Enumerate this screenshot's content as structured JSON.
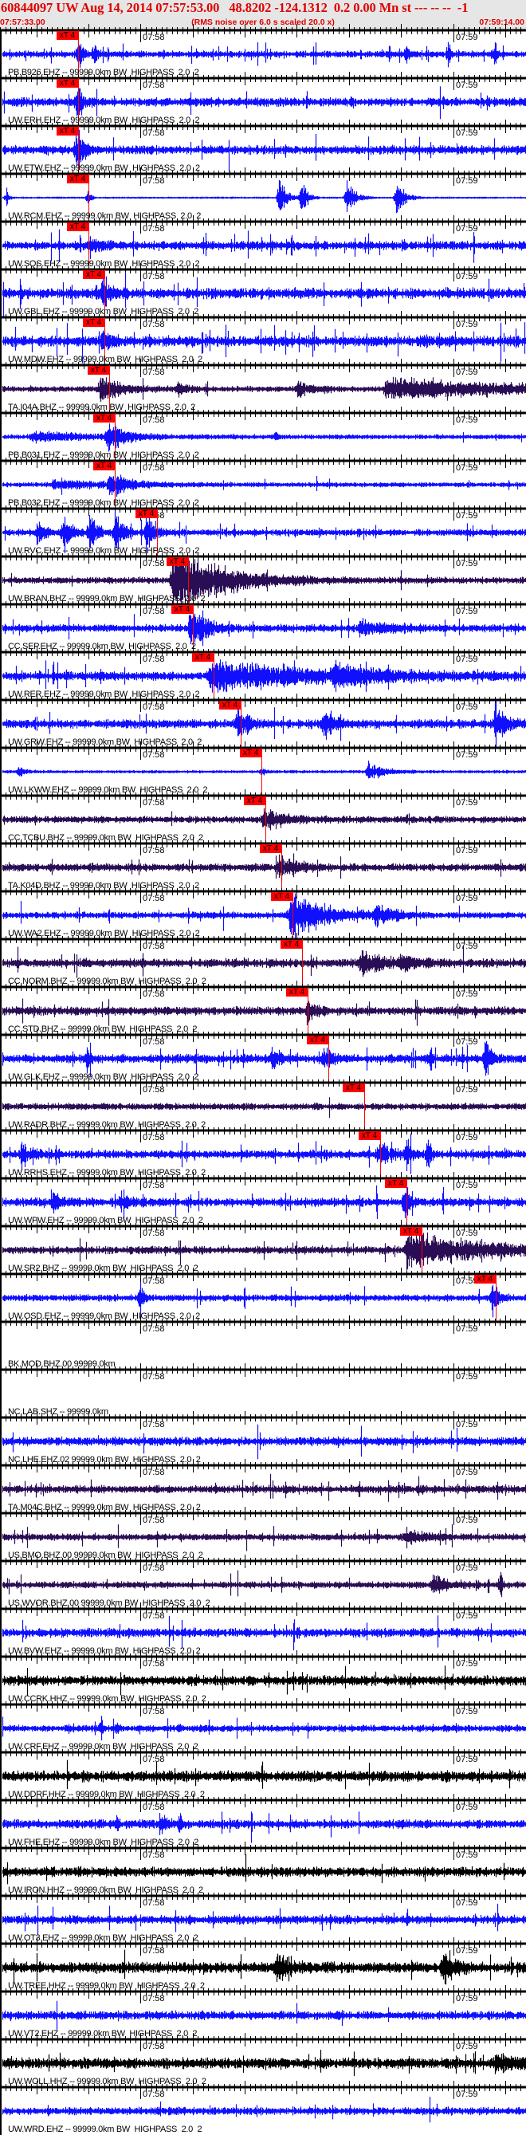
{
  "header": {
    "title": "60844097 UW Aug 14, 2014 07:57:53.00   48.8202 -124.1312  0.2 0.00 Mn st --- -- --  -1",
    "start_time": "07:57:33.00",
    "rms_note": "(RMS noise over 6.0 s scaled 20.0 x)",
    "end_time": "07:59:14.00"
  },
  "axis": {
    "duration_s": 101,
    "minute_marks": [
      {
        "t": 27,
        "label": "07:58"
      },
      {
        "t": 87,
        "label": "07:59"
      }
    ],
    "major_tick_every_s": 10,
    "first_major_s": 7
  },
  "pick_label": "xT 4",
  "colors": {
    "blue": "#1010ff",
    "purple": "#2a0e55",
    "black": "#000000",
    "pick": "#ff0000",
    "header_bg": "#e6e6e6"
  },
  "traces": [
    {
      "label": "PB.B926.EHZ -- 99999.0km BW  HIGHPASS  2.0  2",
      "color": "blue",
      "pick_s": 15.0,
      "noise": 3,
      "spiky": 0.08,
      "events": [
        [
          15,
          26,
          0.6
        ],
        [
          18,
          18,
          0.5
        ],
        [
          78,
          25,
          0.3
        ],
        [
          86,
          18,
          0.4
        ],
        [
          95,
          22,
          0.3
        ]
      ]
    },
    {
      "label": "UW.ERH.EHZ -- 99999.0km BW  HIGHPASS  2.0  2",
      "color": "blue",
      "pick_s": 15.0,
      "noise": 4,
      "spiky": 0.03,
      "events": [
        [
          14.6,
          29,
          1.0
        ]
      ]
    },
    {
      "label": "UW.ETW.EHZ -- 99999.0km BW  HIGHPASS  2.0  2",
      "color": "blue",
      "pick_s": 15.0,
      "noise": 4,
      "spiky": 0.03,
      "events": [
        [
          14.6,
          29,
          1.2
        ]
      ]
    },
    {
      "label": "UW.RCM.EHZ -- 99999.0km BW  HIGHPASS  2.0  2",
      "color": "blue",
      "pick_s": 17.0,
      "noise": 0.6,
      "spiky": 0.0,
      "events": [
        [
          1.2,
          12,
          0.4
        ],
        [
          16.8,
          14,
          0.4
        ],
        [
          53.5,
          25,
          1.2
        ],
        [
          57.8,
          28,
          0.9
        ],
        [
          66.5,
          25,
          1.3
        ],
        [
          76,
          25,
          1.4
        ]
      ]
    },
    {
      "label": "UW.SQS.EHZ -- 99999.0km BW  HIGHPASS  2.0  2",
      "color": "blue",
      "pick_s": 17.0,
      "noise": 4,
      "spiky": 0.04,
      "events": [
        [
          16.8,
          10,
          2
        ]
      ]
    },
    {
      "label": "UW.GBL.EHZ -- 99999.0km BW  HIGHPASS  2.0  2",
      "color": "blue",
      "pick_s": 20.0,
      "noise": 5,
      "spiky": 0.05,
      "events": [
        [
          19.5,
          16,
          1.5
        ]
      ]
    },
    {
      "label": "UW.MDW.EHZ -- 99999.0km BW  HIGHPASS  2.0  2",
      "color": "blue",
      "pick_s": 20.0,
      "noise": 5,
      "spiky": 0.05,
      "events": [
        [
          19.5,
          16,
          1.5
        ]
      ]
    },
    {
      "label": "TA.I04A.BHZ -- 99999.0km BW  HIGHPASS  2.0  2",
      "color": "purple",
      "pick_s": 21.0,
      "noise": 2.5,
      "spiky": 0.02,
      "events": [
        [
          19,
          15,
          4
        ],
        [
          34,
          9,
          1.5
        ],
        [
          57,
          9,
          2.5
        ],
        [
          74,
          11,
          30
        ]
      ]
    },
    {
      "label": "PB.B031.EHZ -- 99999.0km BW  HIGHPASS  2.0  2",
      "color": "blue",
      "pick_s": 22.0,
      "noise": 2,
      "spiky": 0.01,
      "events": [
        [
          6,
          5,
          12
        ],
        [
          20.5,
          18,
          3
        ],
        [
          53,
          9,
          0.2
        ]
      ]
    },
    {
      "label": "PB.B032.EHZ -- 99999.0km BW  HIGHPASS  2.0  2",
      "color": "blue",
      "pick_s": 22.0,
      "noise": 2,
      "spiky": 0.01,
      "events": [
        [
          10,
          5,
          10
        ],
        [
          21,
          16,
          3
        ]
      ]
    },
    {
      "label": "UW.RVC.EHZ -- 99999.0km BW  HIGHPASS  2.0  2",
      "color": "blue",
      "pick_s": 30.1,
      "noise": 3,
      "spiky": 0.04,
      "events": [
        [
          7,
          14,
          1.5
        ],
        [
          12,
          20,
          1.5
        ],
        [
          17,
          24,
          1.2
        ],
        [
          22,
          26,
          1.2
        ],
        [
          28,
          22,
          1.5
        ]
      ]
    },
    {
      "label": "UW.BRAN.BHZ -- 99999.0km BW  HIGHPASS  2.0  2",
      "color": "purple",
      "pick_s": 36.1,
      "noise": 3,
      "spiky": 0.02,
      "events": [
        [
          33,
          40,
          9
        ]
      ]
    },
    {
      "label": "CC.SEP.EHZ -- 99999.0km BW  HIGHPASS  2.0  2",
      "color": "blue",
      "pick_s": 37.0,
      "noise": 3.5,
      "spiky": 0.03,
      "events": [
        [
          36.5,
          30,
          2.5
        ],
        [
          69,
          8,
          5
        ]
      ]
    },
    {
      "label": "UW.RER.EHZ -- 99999.0km BW  HIGHPASS  2.0  2",
      "color": "blue",
      "pick_s": 41.0,
      "noise": 4,
      "spiky": 0.04,
      "events": [
        [
          40,
          16,
          20
        ],
        [
          64,
          12,
          6
        ]
      ]
    },
    {
      "label": "UW.GRW.EHZ -- 99999.0km BW  HIGHPASS  2.0  2",
      "color": "blue",
      "pick_s": 46.2,
      "noise": 4,
      "spiky": 0.02,
      "events": [
        [
          45.5,
          20,
          2
        ],
        [
          62,
          20,
          2
        ],
        [
          95,
          30,
          1.5
        ]
      ]
    },
    {
      "label": "UW.LKWW.EHZ -- 99999.0km BW  HIGHPASS  2.0  2",
      "color": "blue",
      "pick_s": 50.2,
      "noise": 1.2,
      "spiky": 0.0,
      "events": [
        [
          3.5,
          7,
          1
        ],
        [
          50,
          4,
          1
        ],
        [
          70.5,
          13,
          2.5
        ]
      ]
    },
    {
      "label": "CC.TCBU.BHZ -- 99999.0km BW  HIGHPASS  2.0  2",
      "color": "purple",
      "pick_s": 51.0,
      "noise": 3,
      "spiky": 0.02,
      "events": [
        [
          50.5,
          13,
          4
        ]
      ]
    },
    {
      "label": "TA.K04D.BHZ -- 99999.0km BW  HIGHPASS  2.0  2",
      "color": "purple",
      "pick_s": 54.0,
      "noise": 3.5,
      "spiky": 0.03,
      "events": [
        [
          53.5,
          14,
          3
        ]
      ]
    },
    {
      "label": "UW.WA2.EHZ -- 99999.0km BW  HIGHPASS  2.0  2",
      "color": "blue",
      "pick_s": 56.2,
      "noise": 3,
      "spiky": 0.02,
      "events": [
        [
          55.5,
          29,
          6
        ],
        [
          72,
          12,
          3
        ]
      ]
    },
    {
      "label": "CC.NORM.BHZ -- 99999.0km BW  HIGHPASS  2.0  2",
      "color": "purple",
      "pick_s": 58.0,
      "noise": 4,
      "spiky": 0.02,
      "events": [
        [
          69,
          14,
          4
        ],
        [
          77,
          10,
          2
        ]
      ]
    },
    {
      "label": "CC.STD.BHZ -- 99999.0km BW  HIGHPASS  2.0  2",
      "color": "purple",
      "pick_s": 59.1,
      "noise": 4,
      "spiky": 0.02,
      "events": [
        [
          58.8,
          12,
          1.5
        ]
      ]
    },
    {
      "label": "UW.GLK.EHZ -- 99999.0km BW  HIGHPASS  2.0  2",
      "color": "blue",
      "pick_s": 63.0,
      "noise": 4,
      "spiky": 0.05,
      "events": [
        [
          16.8,
          29,
          0.3
        ],
        [
          52,
          12,
          1.5
        ],
        [
          62,
          14,
          1.5
        ],
        [
          82.5,
          29,
          0.3
        ],
        [
          93,
          28,
          1.0
        ]
      ]
    },
    {
      "label": "UW.RADR.BHZ -- 99999.0km BW  HIGHPASS  2.0  2",
      "color": "purple",
      "pick_s": 69.9,
      "noise": 3,
      "spiky": 0.01,
      "events": []
    },
    {
      "label": "UW.RRHS.EHZ -- 99999.0km BW  HIGHPASS  2.0  2",
      "color": "blue",
      "pick_s": 73.0,
      "noise": 4,
      "spiky": 0.05,
      "events": [
        [
          4,
          10,
          2
        ],
        [
          72.5,
          14,
          2
        ],
        [
          78,
          22,
          0.5
        ],
        [
          82,
          20,
          0.5
        ]
      ]
    },
    {
      "label": "UW.WPW.EHZ -- 99999.0km BW  HIGHPASS  2.0  2",
      "color": "blue",
      "pick_s": 78.0,
      "noise": 4,
      "spiky": 0.05,
      "events": [
        [
          10,
          12,
          1.5
        ],
        [
          23,
          12,
          1.5
        ],
        [
          77.5,
          22,
          1
        ]
      ]
    },
    {
      "label": "UW.SR2.BHZ -- 99999.0km BW  HIGHPASS  2.0  2",
      "color": "purple",
      "pick_s": 81.0,
      "noise": 3.5,
      "spiky": 0.03,
      "events": [
        [
          78,
          20,
          15
        ]
      ]
    },
    {
      "label": "UW.OSD.EHZ -- 99999.0km BW  HIGHPASS  2.0  2",
      "color": "blue",
      "pick_s": 95.2,
      "noise": 3,
      "spiky": 0.02,
      "events": [
        [
          26.8,
          22,
          0.6
        ],
        [
          94.5,
          22,
          1
        ]
      ]
    },
    {
      "label": "BK.MOD.BHZ.00 99999.0km",
      "color": "blue",
      "pick_s": null,
      "noise": 0,
      "spiky": 0,
      "events": []
    },
    {
      "label": "NC.LAB.SHZ -- 99999.0km",
      "color": "blue",
      "pick_s": null,
      "noise": 0,
      "spiky": 0,
      "events": []
    },
    {
      "label": "NC.LHE.EHZ.02 99999.0km BW  HIGHPASS  2.0  2",
      "color": "blue",
      "pick_s": null,
      "noise": 4,
      "spiky": 0.02,
      "events": []
    },
    {
      "label": "TA.M04C.BHZ -- 99999.0km BW  HIGHPASS  2.0  2",
      "color": "purple",
      "pick_s": null,
      "noise": 3.5,
      "spiky": 0.03,
      "events": []
    },
    {
      "label": "US.BMO.BHZ.00 99999.0km BW  HIGHPASS  2.0  2",
      "color": "purple",
      "pick_s": null,
      "noise": 3,
      "spiky": 0.03,
      "events": [
        [
          78,
          10,
          3
        ]
      ]
    },
    {
      "label": "US.WVOR.BHZ.00 99999.0km BW  HIGHPASS  2.0  2",
      "color": "purple",
      "pick_s": null,
      "noise": 3,
      "spiky": 0.03,
      "events": [
        [
          83,
          14,
          2
        ],
        [
          96,
          28,
          0.3
        ]
      ]
    },
    {
      "label": "UW.BVW.EHZ -- 99999.0km BW  HIGHPASS  2.0  2",
      "color": "blue",
      "pick_s": null,
      "noise": 4,
      "spiky": 0.03,
      "events": []
    },
    {
      "label": "UW.CCRK.HHZ -- 99999.0km BW  HIGHPASS  2.0  2",
      "color": "black",
      "pick_s": null,
      "noise": 4.5,
      "spiky": 0.02,
      "events": []
    },
    {
      "label": "UW.CRF.EHZ -- 99999.0km BW  HIGHPASS  2.0  2",
      "color": "blue",
      "pick_s": null,
      "noise": 3,
      "spiky": 0.02,
      "events": [
        [
          19.4,
          18,
          0.2
        ],
        [
          22.5,
          18,
          0.2
        ],
        [
          34.5,
          8,
          0.3
        ]
      ]
    },
    {
      "label": "UW.DDRF.HHZ -- 99999.0km BW  HIGHPASS  2.0  2",
      "color": "black",
      "pick_s": null,
      "noise": 5,
      "spiky": 0.02,
      "events": []
    },
    {
      "label": "UW.FHE.EHZ -- 99999.0km BW  HIGHPASS  2.0  2",
      "color": "blue",
      "pick_s": null,
      "noise": 4,
      "spiky": 0.02,
      "events": [
        [
          22.5,
          18,
          0.2
        ],
        [
          30.5,
          10,
          1.5
        ],
        [
          34.5,
          18,
          0.2
        ]
      ]
    },
    {
      "label": "UW.IRON.HHZ -- 99999.0km BW  HIGHPASS  2.0  2",
      "color": "black",
      "pick_s": null,
      "noise": 4.5,
      "spiky": 0.02,
      "events": []
    },
    {
      "label": "UW.OT3.EHZ -- 99999.0km BW  HIGHPASS  2.0  2",
      "color": "blue",
      "pick_s": null,
      "noise": 4,
      "spiky": 0.03,
      "events": []
    },
    {
      "label": "UW.TREE.HHZ -- 99999.0km BW  HIGHPASS  2.0  2",
      "color": "black",
      "pick_s": null,
      "noise": 5,
      "spiky": 0.03,
      "events": [
        [
          53,
          20,
          2
        ],
        [
          85,
          22,
          2
        ]
      ]
    },
    {
      "label": "UW.VT2.EHZ -- 99999.0km BW  HIGHPASS  2.0  2",
      "color": "blue",
      "pick_s": null,
      "noise": 4,
      "spiky": 0.02,
      "events": []
    },
    {
      "label": "UW.WOLL.HHZ -- 99999.0km BW  HIGHPASS  2.0  2",
      "color": "black",
      "pick_s": null,
      "noise": 5,
      "spiky": 0.02,
      "events": [
        [
          95,
          9,
          6
        ]
      ]
    },
    {
      "label": "UW.WRD.EHZ -- 99999.0km BW  HIGHPASS  2.0  2",
      "color": "blue",
      "pick_s": null,
      "noise": 3.5,
      "spiky": 0.02,
      "events": []
    }
  ]
}
